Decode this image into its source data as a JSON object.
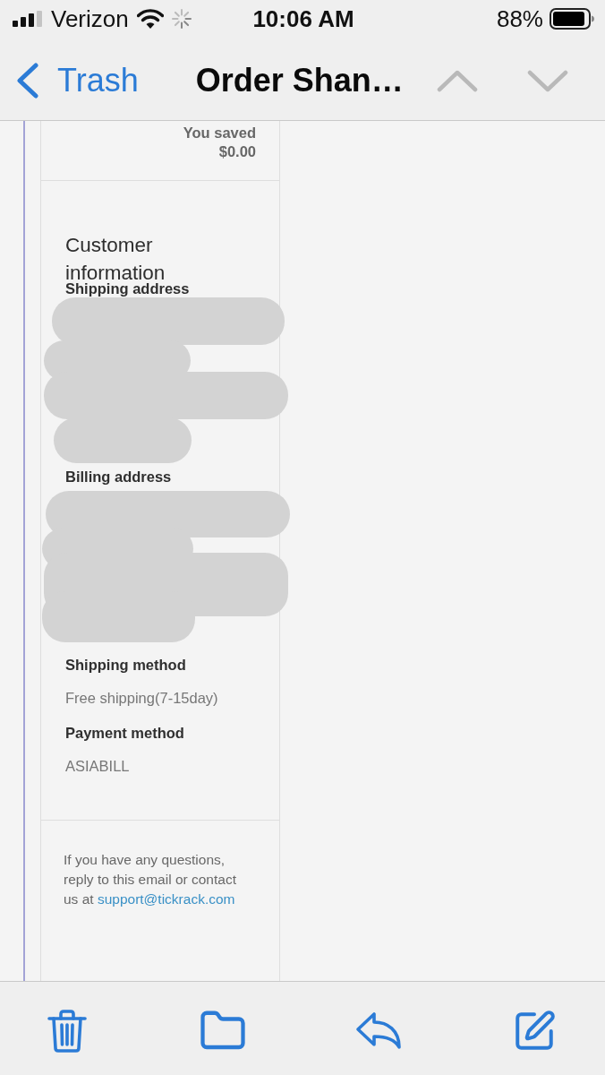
{
  "status_bar": {
    "carrier": "Verizon",
    "time": "10:06 AM",
    "battery": "88%"
  },
  "nav_bar": {
    "back_label": "Trash",
    "title": "Order Shan…",
    "arrows": [
      {
        "kind": "up",
        "disabled": true
      },
      {
        "kind": "down",
        "disabled": true
      }
    ]
  },
  "summary": {
    "label": "You saved",
    "value": "$0.00"
  },
  "customer_information": {
    "title": "Customer information",
    "sections": [
      {
        "kind": "address",
        "label": "Shipping address"
      },
      {
        "kind": "address",
        "label": "Billing address"
      },
      {
        "kind": "text",
        "label": "Shipping method",
        "value": "Free shipping(7-15day)"
      },
      {
        "kind": "text",
        "label": "Payment method",
        "value": "ASIABILL"
      }
    ]
  },
  "footer": {
    "text": "If you have any questions, reply to this email or contact us at",
    "link": "support@tickrack.com"
  },
  "toolbar": [
    {
      "kind": "trash"
    },
    {
      "kind": "folder"
    },
    {
      "kind": "reply"
    },
    {
      "kind": "compose"
    }
  ]
}
